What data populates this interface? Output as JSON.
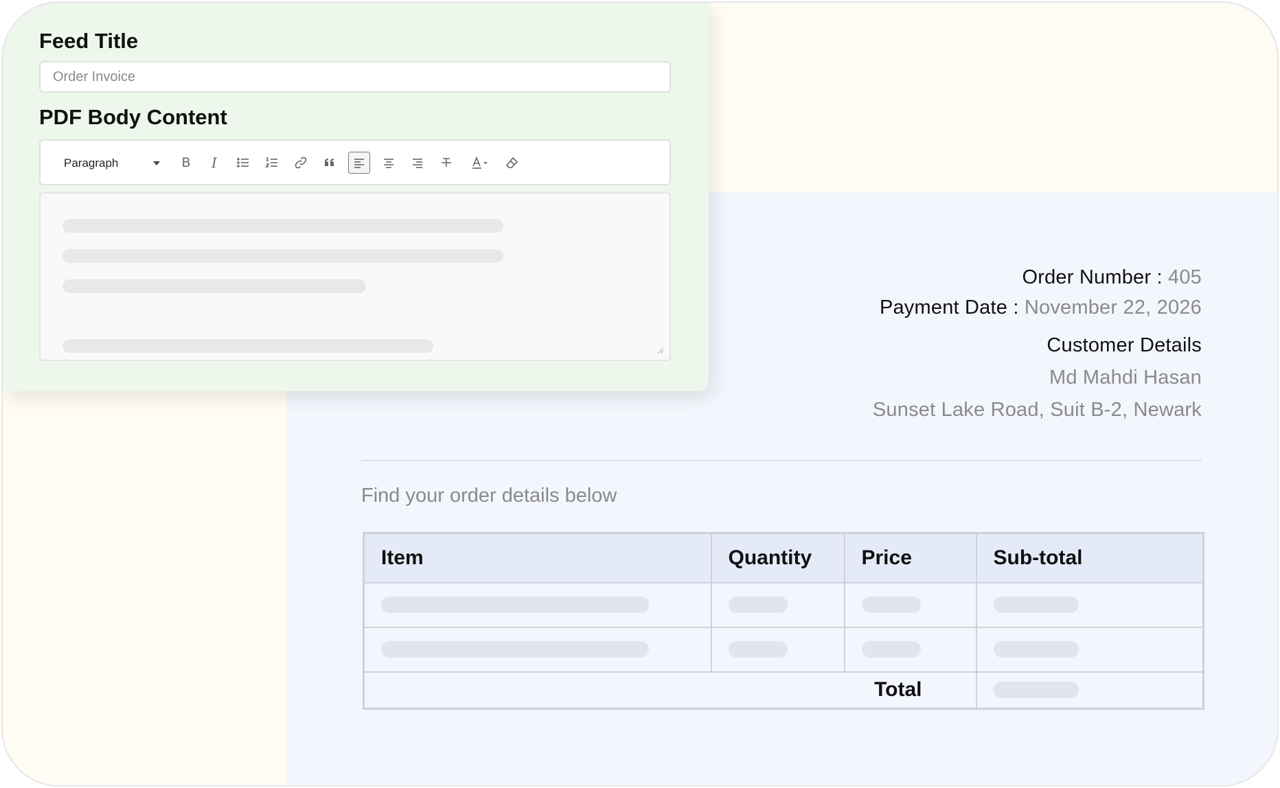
{
  "editor": {
    "feed_title_label": "Feed Title",
    "feed_title_placeholder": "Order Invoice",
    "pdf_body_label": "PDF Body Content",
    "toolbar": {
      "format_value": "Paragraph",
      "buttons": [
        "bold-icon",
        "italic-icon",
        "bulleted-list-icon",
        "numbered-list-icon",
        "link-icon",
        "quote-icon",
        "align-left-icon",
        "align-center-icon",
        "align-right-icon",
        "strikethrough-icon",
        "font-color-icon",
        "eraser-icon"
      ],
      "active_button": "align-left-icon"
    }
  },
  "invoice": {
    "order_number_label": "Order Number :",
    "order_number_value": "405",
    "payment_date_label": "Payment Date :",
    "payment_date_value": "November 22, 2026",
    "customer_details_label": "Customer Details",
    "customer_name": "Md Mahdi Hasan",
    "customer_address": "Sunset Lake Road, Suit B-2, Newark",
    "intro_text": "Find your order details below",
    "table": {
      "headers": [
        "Item",
        "Quantity",
        "Price",
        "Sub-total"
      ],
      "total_label": "Total"
    }
  },
  "colors": {
    "editor_bg": "#edf7ec",
    "page_bg": "#fffdf3",
    "invoice_bg": "#f3f6fc",
    "table_header_bg": "#e4eaf8"
  }
}
